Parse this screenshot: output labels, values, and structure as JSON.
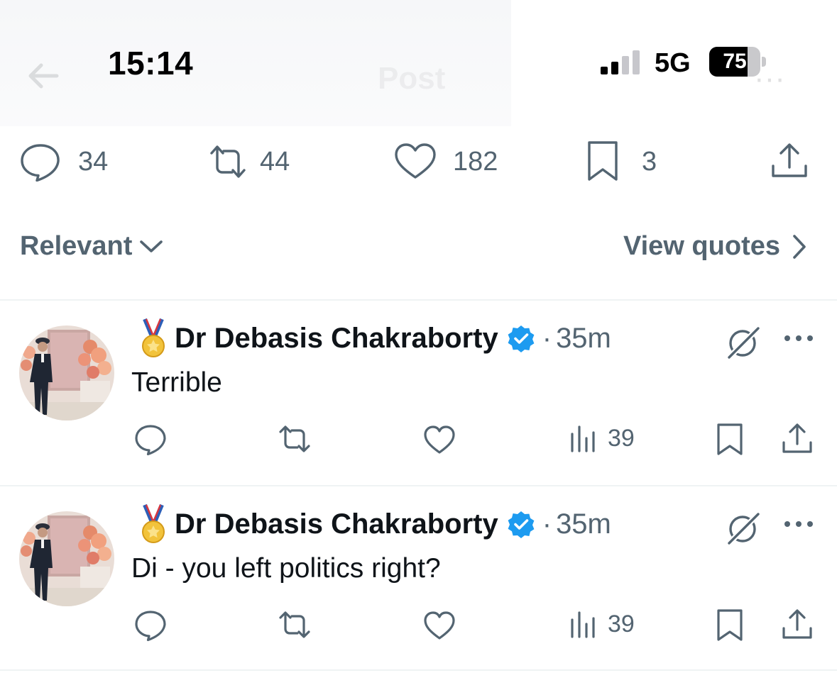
{
  "status_bar": {
    "time": "15:14",
    "network": "5G",
    "battery": "75",
    "battery_level": 0.75
  },
  "header": {
    "title": "Post"
  },
  "post_stats": {
    "replies": "34",
    "reposts": "44",
    "likes": "182",
    "bookmarks": "3"
  },
  "sort": {
    "label": "Relevant",
    "view_quotes": "View quotes"
  },
  "replies": [
    {
      "author": "Dr Debasis Chakraborty",
      "time": "35m",
      "text": "Terrible",
      "views": "39",
      "verified": true
    },
    {
      "author": "Dr Debasis Chakraborty",
      "time": "35m",
      "text": "Di - you left politics right?",
      "views": "39",
      "verified": true
    }
  ],
  "colors": {
    "muted": "#536471",
    "text": "#0f1419",
    "verified": "#1d9bf0",
    "divider": "#eff3f4"
  }
}
